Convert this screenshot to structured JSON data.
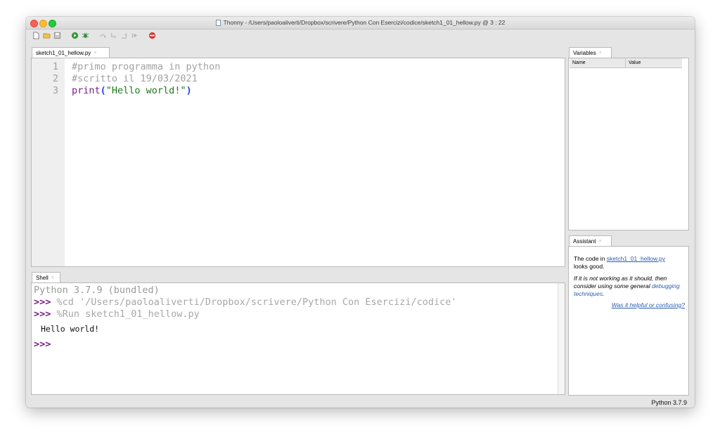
{
  "window": {
    "title": "Thonny  -  /Users/paoloaliverti/Dropbox/scrivere/Python Con Esercizi/codice/sketch1_01_hellow.py  @  3 : 22"
  },
  "toolbar": {
    "icons": [
      "new-file-icon",
      "open-file-icon",
      "save-icon",
      "run-icon",
      "debug-icon",
      "step-over-icon",
      "step-into-icon",
      "step-out-icon",
      "resume-icon",
      "stop-icon"
    ]
  },
  "editor": {
    "tab_label": "sketch1_01_hellow.py",
    "tab_close": "×",
    "line_numbers": [
      "1",
      "2",
      "3"
    ],
    "lines": {
      "comment1": "#primo programma in python",
      "comment2": "#scritto il 19/03/2021",
      "print_kw": "print",
      "paren_open": "(",
      "string": "\"Hello world!\"",
      "paren_close": ")"
    }
  },
  "shell": {
    "tab_label": "Shell",
    "tab_close": "×",
    "banner": "Python 3.7.9 (bundled)",
    "prompt": ">>>",
    "cmd1": "%cd '/Users/paoloaliverti/Dropbox/scrivere/Python Con Esercizi/codice'",
    "cmd2": "%Run sketch1_01_hellow.py",
    "output": "Hello world!"
  },
  "variables": {
    "tab_label": "Variables",
    "tab_close": "×",
    "col_name": "Name",
    "col_value": "Value"
  },
  "assistant": {
    "tab_label": "Assistant",
    "tab_close": "×",
    "line1_prefix": "The code in ",
    "file_link": "sketch1_01_hellow.py",
    "line1_suffix": "looks good.",
    "hint": "If it is not working as it should, then consider using some general ",
    "debug_link": "debugging techniques",
    "hint_end": ".",
    "feedback_link": "Was it helpful or confusing?"
  },
  "statusbar": {
    "version": "Python 3.7.9"
  },
  "colors": {
    "keyword": "#7a1c87",
    "string": "#1d7a1d",
    "comment": "#a2a2a2",
    "paren": "#1f3fff",
    "link": "#2a5db0"
  }
}
